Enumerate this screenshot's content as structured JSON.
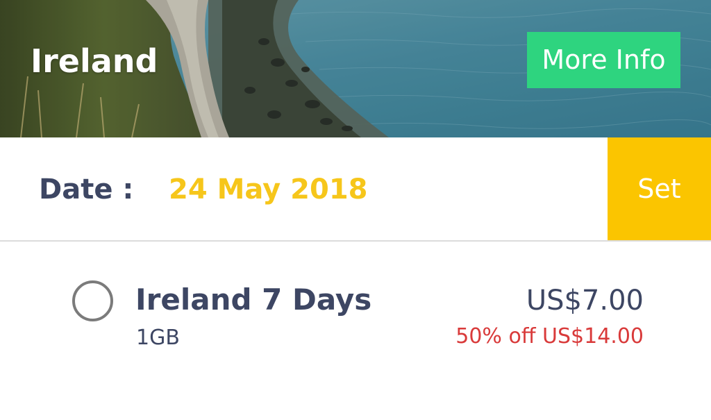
{
  "header": {
    "title": "Ireland",
    "more_info_label": "More Info"
  },
  "date_row": {
    "label": "Date :",
    "value": "24 May 2018",
    "set_label": "Set"
  },
  "plan": {
    "name": "Ireland 7 Days",
    "data": "1GB",
    "price": "US$7.00",
    "discount": "50% off US$14.00",
    "selected": false
  },
  "colors": {
    "accent_green": "#2ed47f",
    "accent_yellow": "#fbc500",
    "date_text": "#f6c61b",
    "primary_text": "#3d4663",
    "discount_red": "#d93a3a"
  },
  "icons": {
    "radio": "radio-unchecked-icon"
  }
}
